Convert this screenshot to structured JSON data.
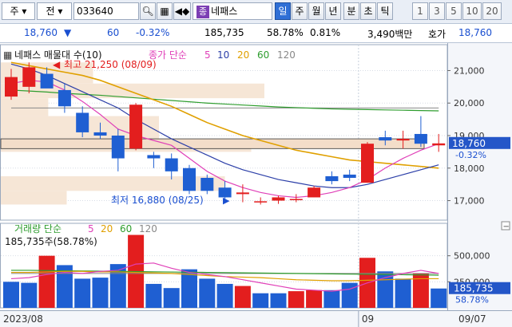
{
  "toolbar": {
    "type_select": "주",
    "gubun_select": "전",
    "code": "033640",
    "stock_name": "네패스",
    "name_badge": "종",
    "period_tabs": [
      "일",
      "주",
      "월",
      "년",
      "분",
      "초",
      "틱"
    ],
    "active_period": "일",
    "intervals": [
      "1",
      "3",
      "5",
      "10",
      "20"
    ]
  },
  "price_bar": {
    "price": "18,760",
    "change": "60",
    "change_pct": "-0.32%",
    "volume": "185,735",
    "vol_ratio": "58.78%",
    "turnover_pct": "0.81%",
    "amount": "3,490백만",
    "quote_label": "호가",
    "quote_price": "18,760"
  },
  "legend": {
    "title": "네패스 매물대 수(10)",
    "ma_label": "종가 단순",
    "ma_periods": [
      "5",
      "10",
      "20",
      "60",
      "120"
    ],
    "high_label": "최고 21,250 (08/09)",
    "low_label": "최저 16,880 (08/25)"
  },
  "volume_legend": {
    "title": "거래량 단순",
    "ma_periods": [
      "5",
      "20",
      "60",
      "120"
    ],
    "value": "185,735주(58.78%)"
  },
  "axis": {
    "price_ticks": [
      "21,000",
      "20,000",
      "19,000",
      "18,000",
      "17,000"
    ],
    "volume_ticks": [
      "500,000",
      "250,000"
    ],
    "current_price": "18,760",
    "current_pct": "-0.32%",
    "current_volume": "185,735",
    "current_vol_pct": "58.78%",
    "date_labels": [
      "2023/08",
      "09",
      "09/07"
    ]
  },
  "colors": {
    "up": "#e31e1e",
    "down": "#1f5fd2",
    "ma5": "#e040b8",
    "ma10": "#2c3fa8",
    "ma20": "#e0a000",
    "ma60": "#2e9d2e",
    "ma120": "#888888",
    "profile": "#f6e6d6"
  },
  "chart_data": {
    "type": "candlestick",
    "price_axis": [
      16400,
      21600
    ],
    "candles": [
      {
        "o": 20200,
        "h": 21050,
        "l": 20100,
        "c": 20800
      },
      {
        "o": 20500,
        "h": 21250,
        "l": 20300,
        "c": 21100
      },
      {
        "o": 20900,
        "h": 21100,
        "l": 20500,
        "c": 20450
      },
      {
        "o": 20400,
        "h": 20600,
        "l": 19700,
        "c": 19900
      },
      {
        "o": 19700,
        "h": 19900,
        "l": 18950,
        "c": 19100
      },
      {
        "o": 19100,
        "h": 19400,
        "l": 18900,
        "c": 19000
      },
      {
        "o": 19000,
        "h": 19200,
        "l": 17900,
        "c": 18300
      },
      {
        "o": 18600,
        "h": 20000,
        "l": 18550,
        "c": 19950
      },
      {
        "o": 18400,
        "h": 18500,
        "l": 18000,
        "c": 18300
      },
      {
        "o": 18300,
        "h": 18450,
        "l": 17650,
        "c": 17900
      },
      {
        "o": 18000,
        "h": 18100,
        "l": 17200,
        "c": 17300
      },
      {
        "o": 17700,
        "h": 17800,
        "l": 17200,
        "c": 17300
      },
      {
        "o": 17400,
        "h": 17600,
        "l": 17000,
        "c": 17100
      },
      {
        "o": 17200,
        "h": 17500,
        "l": 16950,
        "c": 17250
      },
      {
        "o": 16950,
        "h": 17100,
        "l": 16880,
        "c": 16980
      },
      {
        "o": 17000,
        "h": 17150,
        "l": 16900,
        "c": 17100
      },
      {
        "o": 17050,
        "h": 17200,
        "l": 16950,
        "c": 17050
      },
      {
        "o": 17100,
        "h": 17450,
        "l": 17100,
        "c": 17400
      },
      {
        "o": 17750,
        "h": 17900,
        "l": 17500,
        "c": 17600
      },
      {
        "o": 17800,
        "h": 17950,
        "l": 17600,
        "c": 17700
      },
      {
        "o": 17550,
        "h": 18800,
        "l": 17550,
        "c": 18750
      },
      {
        "o": 18950,
        "h": 19150,
        "l": 18700,
        "c": 18850
      },
      {
        "o": 18850,
        "h": 19150,
        "l": 18600,
        "c": 18900
      },
      {
        "o": 19050,
        "h": 19600,
        "l": 18650,
        "c": 18750
      },
      {
        "o": 18700,
        "h": 19050,
        "l": 18500,
        "c": 18760
      }
    ],
    "volume_axis": [
      0,
      750000
    ],
    "volumes": [
      {
        "v": 250000,
        "up": false
      },
      {
        "v": 240000,
        "up": false
      },
      {
        "v": 500000,
        "up": true
      },
      {
        "v": 410000,
        "up": false
      },
      {
        "v": 280000,
        "up": false
      },
      {
        "v": 290000,
        "up": false
      },
      {
        "v": 420000,
        "up": false
      },
      {
        "v": 700000,
        "up": true
      },
      {
        "v": 230000,
        "up": false
      },
      {
        "v": 190000,
        "up": false
      },
      {
        "v": 370000,
        "up": false
      },
      {
        "v": 280000,
        "up": false
      },
      {
        "v": 230000,
        "up": false
      },
      {
        "v": 210000,
        "up": true
      },
      {
        "v": 140000,
        "up": false
      },
      {
        "v": 140000,
        "up": false
      },
      {
        "v": 160000,
        "up": true
      },
      {
        "v": 170000,
        "up": true
      },
      {
        "v": 170000,
        "up": false
      },
      {
        "v": 240000,
        "up": false
      },
      {
        "v": 480000,
        "up": true
      },
      {
        "v": 350000,
        "up": false
      },
      {
        "v": 280000,
        "up": false
      },
      {
        "v": 330000,
        "up": true
      },
      {
        "v": 185735,
        "up": false
      }
    ],
    "ma5": [
      20600,
      20700,
      20650,
      20400,
      20050,
      19650,
      19200,
      19000,
      18850,
      18700,
      18300,
      17900,
      17600,
      17400,
      17250,
      17150,
      17100,
      17150,
      17250,
      17400,
      17650,
      18000,
      18300,
      18550,
      18750
    ],
    "ma10": [
      21200,
      21050,
      20850,
      20600,
      20350,
      20100,
      19850,
      19500,
      19200,
      18900,
      18650,
      18400,
      18150,
      17950,
      17800,
      17650,
      17550,
      17450,
      17400,
      17400,
      17500,
      17650,
      17800,
      17950,
      18100
    ],
    "ma20": [
      21250,
      21150,
      21050,
      20950,
      20850,
      20700,
      20500,
      20300,
      20100,
      19900,
      19650,
      19400,
      19200,
      19000,
      18850,
      18700,
      18550,
      18450,
      18350,
      18250,
      18200,
      18150,
      18100,
      18050,
      18000
    ],
    "ma60": [
      20400,
      20370,
      20340,
      20300,
      20270,
      20240,
      20200,
      20160,
      20120,
      20080,
      20040,
      20000,
      19970,
      19940,
      19910,
      19880,
      19860,
      19840,
      19820,
      19810,
      19800,
      19790,
      19780,
      19770,
      19760
    ],
    "ma120": [
      19850,
      19850,
      19850,
      19850,
      19850,
      19850,
      19850,
      19850,
      19850,
      19850,
      19850,
      19850,
      19850,
      19850,
      19850,
      19850,
      19850,
      19850,
      19850,
      19850,
      19850,
      19850,
      19850,
      19850,
      19850
    ],
    "vol_ma5": [
      280000,
      290000,
      320000,
      340000,
      330000,
      350000,
      360000,
      420000,
      430000,
      380000,
      340000,
      320000,
      300000,
      270000,
      240000,
      210000,
      180000,
      170000,
      160000,
      180000,
      240000,
      290000,
      330000,
      360000,
      330000
    ],
    "vol_ma20": [
      340000,
      340000,
      345000,
      350000,
      350000,
      345000,
      345000,
      340000,
      335000,
      330000,
      320000,
      310000,
      300000,
      295000,
      290000,
      280000,
      270000,
      265000,
      260000,
      260000,
      265000,
      270000,
      275000,
      280000,
      280000
    ],
    "vol_ma60": [
      360000,
      360000,
      358000,
      356000,
      354000,
      352000,
      350000,
      348000,
      346000,
      344000,
      342000,
      340000,
      338000,
      336000,
      334000,
      332000,
      330000,
      328000,
      326000,
      324000,
      322000,
      320000,
      318000,
      316000,
      314000
    ],
    "vol_ma120": [
      330000,
      330000,
      330000,
      330000,
      330000,
      330000,
      330000,
      330000,
      330000,
      330000,
      330000,
      330000,
      330000,
      330000,
      330000,
      330000,
      330000,
      330000,
      330000,
      330000,
      330000,
      330000,
      330000,
      330000,
      330000
    ],
    "volume_profile": [
      {
        "lo": 20600,
        "hi": 21250,
        "w": 0.35
      },
      {
        "lo": 20150,
        "hi": 20600,
        "w": 1.0
      },
      {
        "lo": 19600,
        "hi": 20150,
        "w": 0.18
      },
      {
        "lo": 18900,
        "hi": 19600,
        "w": 0.6
      },
      {
        "lo": 18500,
        "hi": 18900,
        "w": 0.95
      },
      {
        "lo": 17300,
        "hi": 17750,
        "w": 0.85
      },
      {
        "lo": 16880,
        "hi": 17300,
        "w": 0.25
      }
    ]
  }
}
